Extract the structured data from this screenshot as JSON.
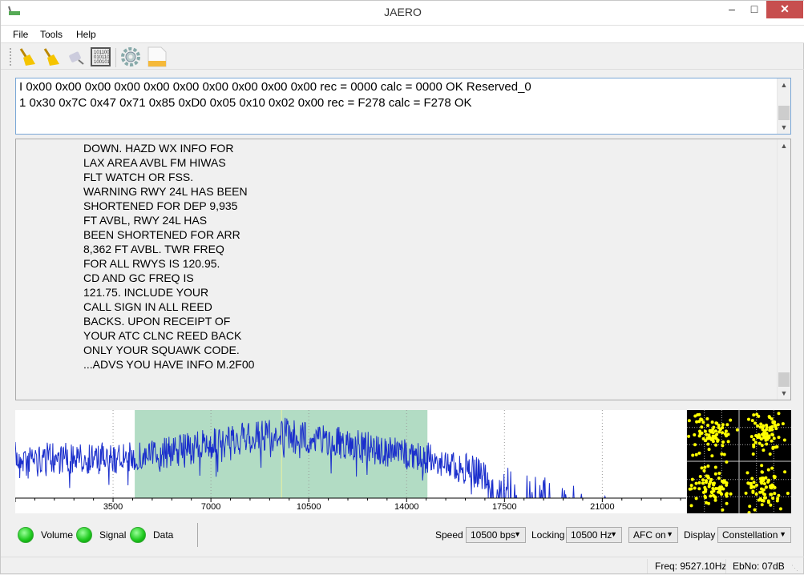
{
  "window": {
    "title": "JAERO",
    "minimize_icon": "minimize-icon",
    "maximize_icon": "maximize-icon",
    "close_icon": "close-icon",
    "close_color": "#c74e4e"
  },
  "menu": [
    "File",
    "Tools",
    "Help"
  ],
  "toolbar": [
    {
      "icon": "broom-icon"
    },
    {
      "icon": "broom-icon"
    },
    {
      "icon": "plug-icon"
    },
    {
      "icon": "binary-icon"
    },
    {
      "icon": "gear-icon"
    },
    {
      "icon": "log-file-icon"
    }
  ],
  "output_top": {
    "lines": [
      "I 0x00 0x00 0x00 0x00 0x00 0x00 0x00 0x00 0x00 0x00 rec = 0000 calc = 0000 OK Reserved_0",
      "1 0x30 0x7C 0x47 0x71 0x85 0xD0 0x05 0x10 0x02 0x00 rec = F278 calc = F278 OK"
    ]
  },
  "output_main": {
    "lines": [
      "DOWN. HAZD WX INFO FOR",
      "LAX AREA AVBL FM HIWAS",
      "FLT WATCH OR FSS.",
      "WARNING RWY 24L HAS BEEN",
      "SHORTENED FOR DEP 9,935",
      "FT AVBL, RWY 24L HAS",
      "BEEN SHORTENED FOR ARR",
      "8,362 FT AVBL. TWR FREQ",
      "FOR ALL RWYS IS 120.95.",
      "CD AND GC FREQ IS",
      "121.75. INCLUDE YOUR",
      "CALL SIGN IN ALL REED",
      "BACKS. UPON RECEIPT OF",
      "YOUR ATC CLNC REED BACK",
      "ONLY YOUR SQUAWK CODE.",
      "...ADVS YOU HAVE INFO M.2F00"
    ]
  },
  "spectrum": {
    "ticks": [
      "3500",
      "7000",
      "10500",
      "14000",
      "17500",
      "21000"
    ],
    "xlim": [
      0,
      24000
    ],
    "band": [
      4275,
      14745
    ],
    "marker": 9527,
    "trace_color": "#1a2ecc",
    "band_color": "#b2dcc4"
  },
  "constellation": {
    "point_color": "#ffff00",
    "background": "#000000"
  },
  "indicators": [
    {
      "label": "Volume",
      "state": "on"
    },
    {
      "label": "Signal",
      "state": "on"
    },
    {
      "label": "Data",
      "state": "on"
    }
  ],
  "controls": {
    "speed_label": "Speed",
    "speed": "10500 bps",
    "locking_label": "Locking",
    "locking": "10500 Hz",
    "afc": "AFC on",
    "display_label": "Display",
    "display": "Constellation"
  },
  "status": {
    "freq": "Freq: 9527.10Hz",
    "ebno": "EbNo: 07dB"
  }
}
